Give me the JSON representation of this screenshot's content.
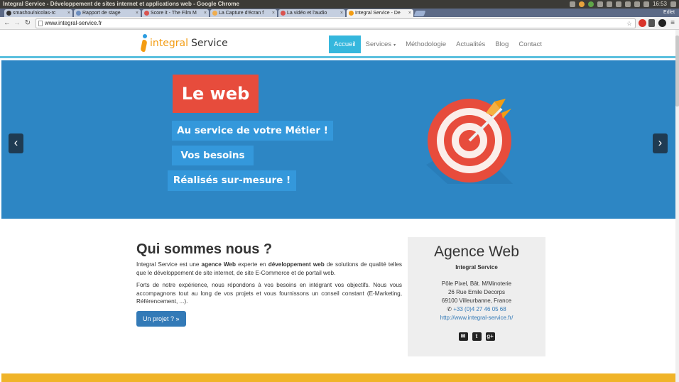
{
  "os": {
    "window_title": "Integral Service - Développement de sites internet et applications web - Google Chrome",
    "clock": "16:53",
    "user": "Edlet"
  },
  "tabs": [
    {
      "label": "smashou/nicolas-rc",
      "favicon_color": "#333333"
    },
    {
      "label": "Rapport de stage",
      "favicon_color": "#6c8ebf"
    },
    {
      "label": "Score it - The Film M",
      "favicon_color": "#d9534f"
    },
    {
      "label": "La Capture d'écran f",
      "favicon_color": "#f0ad4e"
    },
    {
      "label": "La vidéo et l'audio",
      "favicon_color": "#d9534f"
    },
    {
      "label": "Integral Service - De",
      "favicon_color": "#f39c12"
    }
  ],
  "browser": {
    "url": "www.integral-service.fr"
  },
  "site": {
    "logo": {
      "part1": "integral",
      "part2": "Service"
    },
    "nav": [
      {
        "label": "Accueil"
      },
      {
        "label": "Services",
        "caret": "▾"
      },
      {
        "label": "Méthodologie"
      },
      {
        "label": "Actualités"
      },
      {
        "label": "Blog"
      },
      {
        "label": "Contact"
      }
    ]
  },
  "hero": {
    "title": "Le web",
    "line1": "Au service de votre Métier !",
    "line2": "Vos besoins",
    "line3": "Réalisés sur-mesure !",
    "prev_icon": "chevron-left-icon",
    "next_icon": "chevron-right-icon"
  },
  "about": {
    "title": "Qui sommes nous ?",
    "p1_a": "Integral Service est une ",
    "p1_b": "agence Web",
    "p1_c": " experte en ",
    "p1_d": "développement web",
    "p1_e": " de solutions de qualité telles que le développement de site internet, de site E-Commerce et de portail web.",
    "p2": "Forts de notre expérience, nous répondons à vos besoins en intégrant vos objectifs. Nous vous accompagnons tout au long de vos projets et vous fournissons un conseil constant (E-Marketing, Référencement, ...).",
    "cta": "Un projet ? »"
  },
  "agency": {
    "title": "Agence Web",
    "name": "Integral Service",
    "address1": "Pôle Pixel, Bât. M/Minoterie",
    "address2": "26 Rue Emile Decorps",
    "address3": "69100 Villeurbanne, France",
    "phone": "+33 (0)4 27 46 05 68",
    "website": "http://www.integral-service.fr/",
    "social": [
      "email-icon",
      "twitter-icon",
      "google-plus-icon"
    ]
  },
  "colors": {
    "hero_bg": "#2d86c4",
    "title_red": "#e74c3c",
    "nav_active": "#35b7dd",
    "accent_orange": "#f39c12",
    "footer_yellow": "#f0b429"
  }
}
